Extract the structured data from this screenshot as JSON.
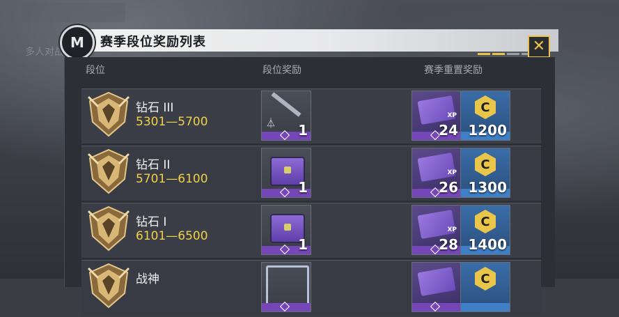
{
  "background": {
    "faded_text": "多人对战"
  },
  "panel": {
    "logo_letter": "M",
    "title": "赛季段位奖励列表",
    "close_label": "✕",
    "headers": {
      "rank": "段位",
      "rank_reward": "段位奖励",
      "season_reward": "赛季重置奖励"
    },
    "rows": [
      {
        "name": "钻石 III",
        "range": "5301—5700",
        "rank_reward_qty": "1",
        "rank_reward_type": "weapon",
        "xp_qty": "24",
        "cp_qty": "1200",
        "cp_letter": "C",
        "xp_label": "XP"
      },
      {
        "name": "钻石 II",
        "range": "5701—6100",
        "rank_reward_qty": "1",
        "rank_reward_type": "crate",
        "xp_qty": "26",
        "cp_qty": "1300",
        "cp_letter": "C",
        "xp_label": "XP"
      },
      {
        "name": "钻石 I",
        "range": "6101—6500",
        "rank_reward_qty": "1",
        "rank_reward_type": "crate",
        "xp_qty": "28",
        "cp_qty": "1400",
        "cp_letter": "C",
        "xp_label": "XP"
      },
      {
        "name": "战神",
        "range": "",
        "rank_reward_qty": "",
        "rank_reward_type": "frame",
        "xp_qty": "",
        "cp_qty": "",
        "cp_letter": "C",
        "xp_label": ""
      }
    ]
  },
  "colors": {
    "accent": "#e8c24a",
    "range_text": "#f0d24a",
    "purple_bar": "#7446b8",
    "blue_bar": "#3f7fc6"
  }
}
